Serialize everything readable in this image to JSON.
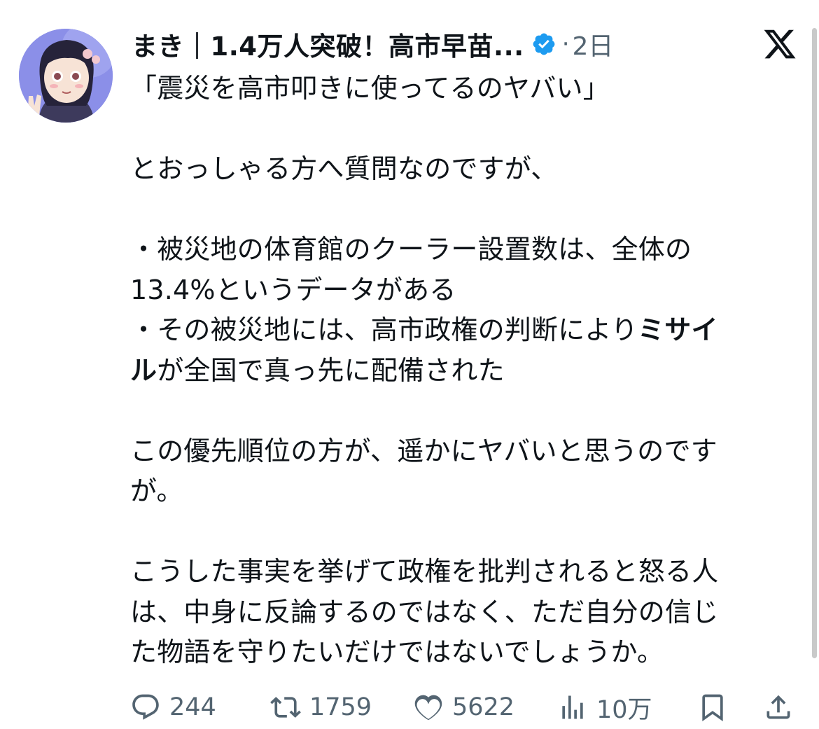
{
  "tweet": {
    "author_name": "まき｜1.4万人突破！高市早苗...",
    "time": "2日",
    "separator": "·",
    "text": {
      "quote": "「震災を高市叩きに使ってるのヤバい」",
      "question": "とおっしゃる方へ質問なのですが、",
      "bullet1_line1": "・被災地の体育館のクーラー設置数は、全体の",
      "bullet1_line2": "13.4%というデータがある",
      "bullet2_pre": "・その被災地には、高市政権の判断により",
      "bullet2_bold1": "ミサイ",
      "bullet2_bold2": "ル",
      "bullet2_post": "が全国で真っ先に配備された",
      "priority_line1": "この優先順位の方が、遥かにヤバいと思うのです",
      "priority_line2": "が。",
      "closing_line1": "こうした事実を挙げて政権を批判されると怒る人",
      "closing_line2": "は、中身に反論するのではなく、ただ自分の信じ",
      "closing_line3": "た物語を守りたいだけではないでしょうか。"
    },
    "actions": {
      "replies": "244",
      "retweets": "1759",
      "likes": "5622",
      "views": "10万"
    }
  },
  "icons": [
    "avatar",
    "verified-badge-icon",
    "x-logo-icon",
    "reply-icon",
    "retweet-icon",
    "like-icon",
    "views-icon",
    "bookmark-icon",
    "share-icon"
  ],
  "colors": {
    "verified": "#1d9bf0",
    "muted": "#536471",
    "text": "#0f1419"
  }
}
